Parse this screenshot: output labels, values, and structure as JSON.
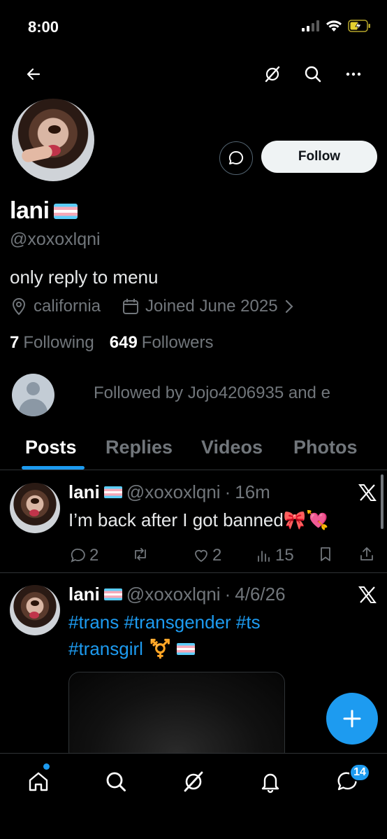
{
  "status_bar": {
    "time": "8:00"
  },
  "profile": {
    "display_name": "lani",
    "handle": "@xoxoxlqni",
    "bio": "only reply to menu",
    "location": "california",
    "joined": "Joined June 2025",
    "following_count": "7",
    "following_label": "Following",
    "followers_count": "649",
    "followers_label": "Followers",
    "followed_by": "Followed by Jojo4206935 and e",
    "follow_label": "Follow"
  },
  "tabs": [
    {
      "label": "Posts",
      "active": true
    },
    {
      "label": "Replies",
      "active": false
    },
    {
      "label": "Videos",
      "active": false
    },
    {
      "label": "Photos",
      "active": false
    }
  ],
  "posts": [
    {
      "name": "lani",
      "handle": "@xoxoxlqni",
      "sep": "·",
      "time": "16m",
      "text": "I’m back after I got banned",
      "emoji": "🎀💘",
      "replies": "2",
      "reposts": "",
      "likes": "2",
      "views": "15"
    },
    {
      "name": "lani",
      "handle": "@xoxoxlqni",
      "sep": "·",
      "time": "4/6/26",
      "tags_line1": "#trans #transgender #ts",
      "tags_line2": "#transgirl",
      "emoji": "⚧️"
    }
  ],
  "bottom_nav": {
    "messages_badge": "14"
  },
  "colors": {
    "accent": "#1d9bf0",
    "secondary_text": "#71767b",
    "background": "#000000"
  }
}
